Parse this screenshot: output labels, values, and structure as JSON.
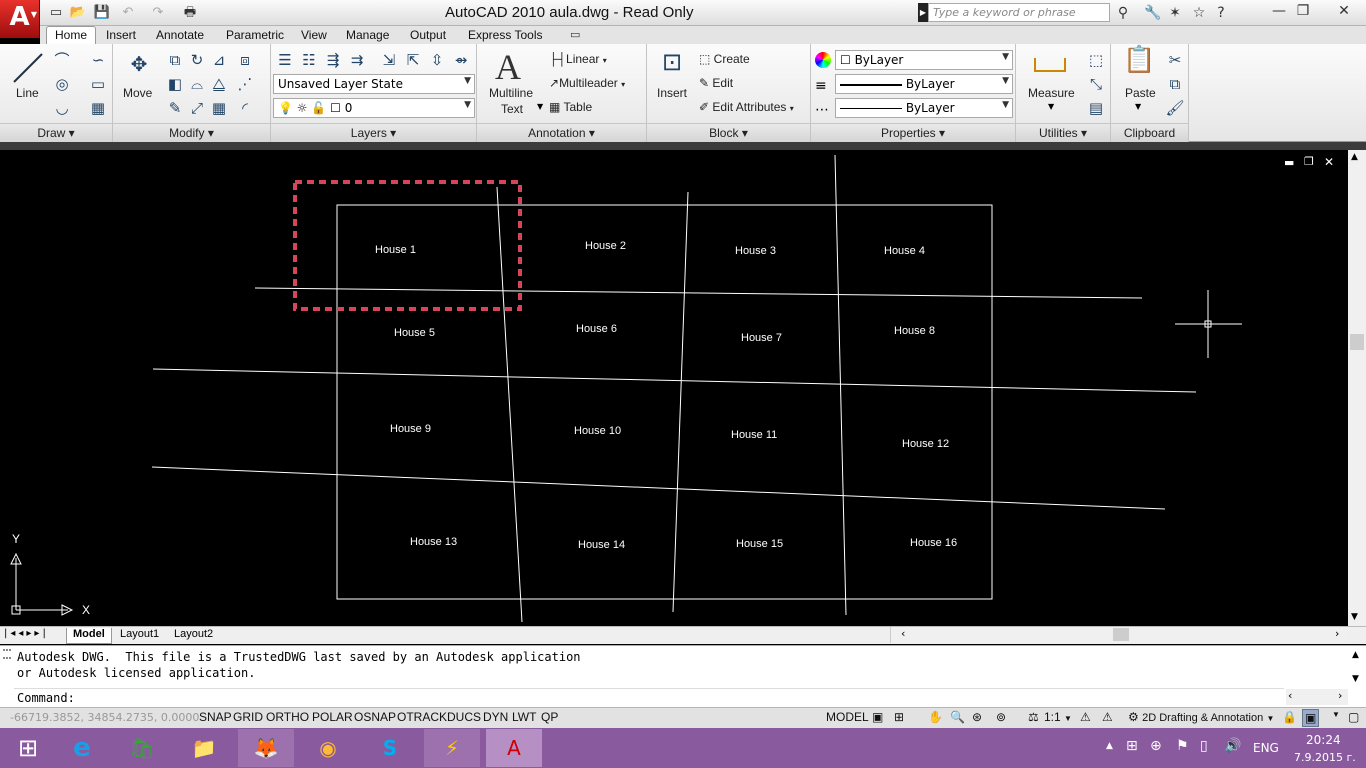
{
  "app": {
    "logo": "A",
    "title": "AutoCAD 2010      aula.dwg - Read Only",
    "search_placeholder": "Type a keyword or phrase"
  },
  "tabs": [
    "Home",
    "Insert",
    "Annotate",
    "Parametric",
    "View",
    "Manage",
    "Output",
    "Express Tools"
  ],
  "ribbon": {
    "draw": {
      "title": "Draw",
      "line": "Line"
    },
    "modify": {
      "title": "Modify",
      "move": "Move"
    },
    "layers": {
      "title": "Layers",
      "state": "Unsaved Layer State",
      "layer": "0"
    },
    "annotation": {
      "title": "Annotation",
      "mtext1": "Multiline",
      "mtext2": "Text",
      "linear": "Linear",
      "multileader": "Multileader",
      "table": "Table"
    },
    "block": {
      "title": "Block",
      "insert": "Insert",
      "create": "Create",
      "edit": "Edit",
      "edit_attributes": "Edit Attributes"
    },
    "properties": {
      "title": "Properties",
      "color": "ByLayer",
      "linetype": "ByLayer",
      "lineweight": "ByLayer"
    },
    "utilities": {
      "title": "Utilities",
      "measure": "Measure"
    },
    "clipboard": {
      "title": "Clipboard",
      "paste": "Paste"
    }
  },
  "drawing": {
    "houses": [
      "House 1",
      "House 2",
      "House 3",
      "House 4",
      "House 5",
      "House 6",
      "House 7",
      "House 8",
      "House 9",
      "House 10",
      "House 11",
      "House 12",
      "House 13",
      "House 14",
      "House 15",
      "House 16"
    ],
    "ucs_y": "Y",
    "ucs_x": "X"
  },
  "layout_tabs": [
    "Model",
    "Layout1",
    "Layout2"
  ],
  "command": {
    "line1": "Autodesk DWG.  This file is a TrustedDWG last saved by an Autodesk application",
    "line2": "or Autodesk licensed application.",
    "prompt": "Command:"
  },
  "status": {
    "coords": "-66719.3852, 34854.2735, 0.0000",
    "toggles": [
      "SNAP",
      "GRID",
      "ORTHO",
      "POLAR",
      "OSNAP",
      "OTRACK",
      "DUCS",
      "DYN",
      "LWT",
      "QP"
    ],
    "model": "MODEL",
    "scale": "1:1",
    "workspace": "2D Drafting & Annotation"
  },
  "taskbar": {
    "lang": "ENG",
    "time": "20:24",
    "date": "7.9.2015 г."
  },
  "colors": {
    "selection_dash": "#d6455a",
    "taskbar": "#8a5a9e",
    "logo": "#c8201b"
  }
}
